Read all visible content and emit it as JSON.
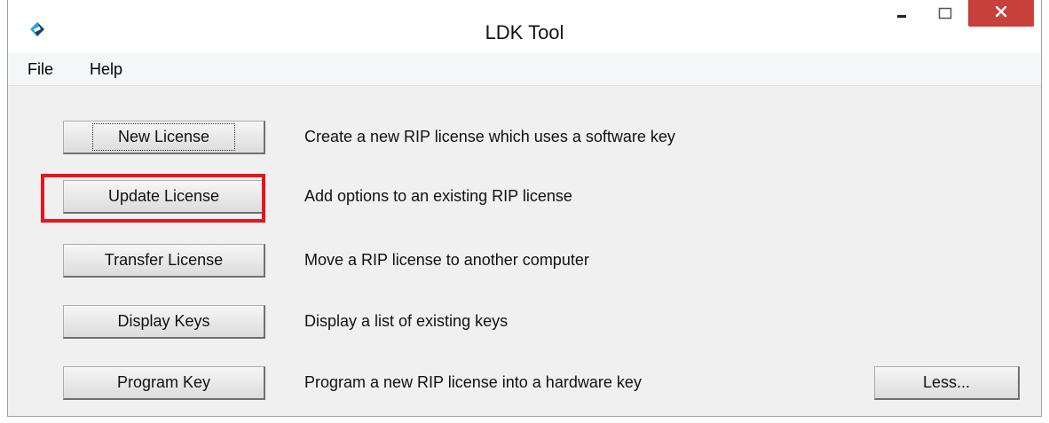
{
  "window": {
    "title": "LDK Tool",
    "close_color": "#c7403a"
  },
  "menu": {
    "items": [
      "File",
      "Help"
    ]
  },
  "actions": [
    {
      "label": "New License",
      "description": "Create a new RIP license which uses a software key",
      "focused": true
    },
    {
      "label": "Update License",
      "description": "Add options to an existing RIP license",
      "highlighted": true
    },
    {
      "label": "Transfer License",
      "description": "Move a RIP license to another computer"
    },
    {
      "label": "Display Keys",
      "description": "Display a list of existing keys"
    },
    {
      "label": "Program Key",
      "description": "Program a new RIP license into a hardware key"
    }
  ],
  "less_button": {
    "label": "Less..."
  },
  "icons": {
    "app": "ldk-app-icon",
    "minimize": "minimize-icon",
    "maximize": "maximize-icon",
    "close": "close-icon"
  },
  "highlight_color": "#e8141e"
}
